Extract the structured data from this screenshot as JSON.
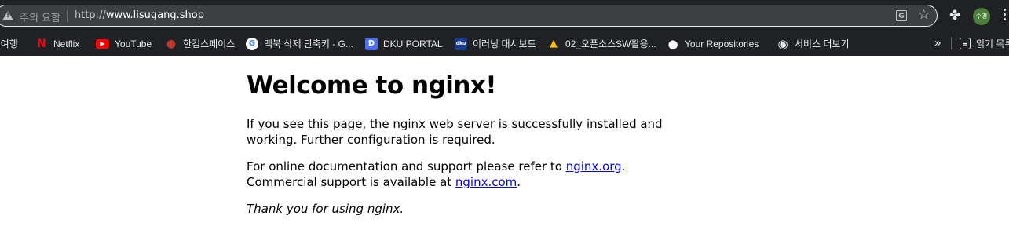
{
  "browser": {
    "security_label": "주의 요함",
    "url_scheme": "http://",
    "url_host": "www.lisugang.shop",
    "avatar_label": "수경",
    "translate_glyph": "G",
    "star_glyph": "☆",
    "extensions_glyph": "✤"
  },
  "bookmarks": [
    {
      "label": "l여행",
      "icon": "partial-bookmark",
      "color": "#202124"
    },
    {
      "label": "Netflix",
      "icon": "netflix-icon",
      "color": "#e50914",
      "glyph": "N"
    },
    {
      "label": "YouTube",
      "icon": "youtube-icon",
      "color": "#ff0000",
      "glyph": "▶"
    },
    {
      "label": "한컴스페이스",
      "icon": "hancom-icon",
      "color": "#c0392b",
      "glyph": "●"
    },
    {
      "label": "맥북 삭제 단축키 - G...",
      "icon": "google-icon",
      "color": "#ffffff",
      "glyph": "G"
    },
    {
      "label": "DKU PORTAL",
      "icon": "dku-portal-icon",
      "color": "#4e6ef2",
      "glyph": "D"
    },
    {
      "label": "이러닝 대시보드",
      "icon": "dku-elearning-icon",
      "color": "#1a3c8c",
      "glyph": "dku"
    },
    {
      "label": "02_오픈소스SW활용...",
      "icon": "google-drive-icon",
      "color": "#34a853",
      "glyph": "▲"
    },
    {
      "label": "Your Repositories",
      "icon": "github-icon",
      "color": "#ffffff",
      "glyph": "●"
    },
    {
      "label": "서비스 더보기",
      "icon": "globe-icon",
      "color": "#ffffff",
      "glyph": "◉"
    }
  ],
  "bookmarks_overflow": "»",
  "reading_list": "읽기 목록",
  "page": {
    "heading": "Welcome to nginx!",
    "p1": "If you see this page, the nginx web server is successfully installed and working. Further configuration is required.",
    "p2_prefix": "For online documentation and support please refer to ",
    "link1": "nginx.org",
    "p2_mid": ".",
    "p2_line2_prefix": "Commercial support is available at ",
    "link2": "nginx.com",
    "p2_suffix": ".",
    "thanks": "Thank you for using nginx."
  }
}
